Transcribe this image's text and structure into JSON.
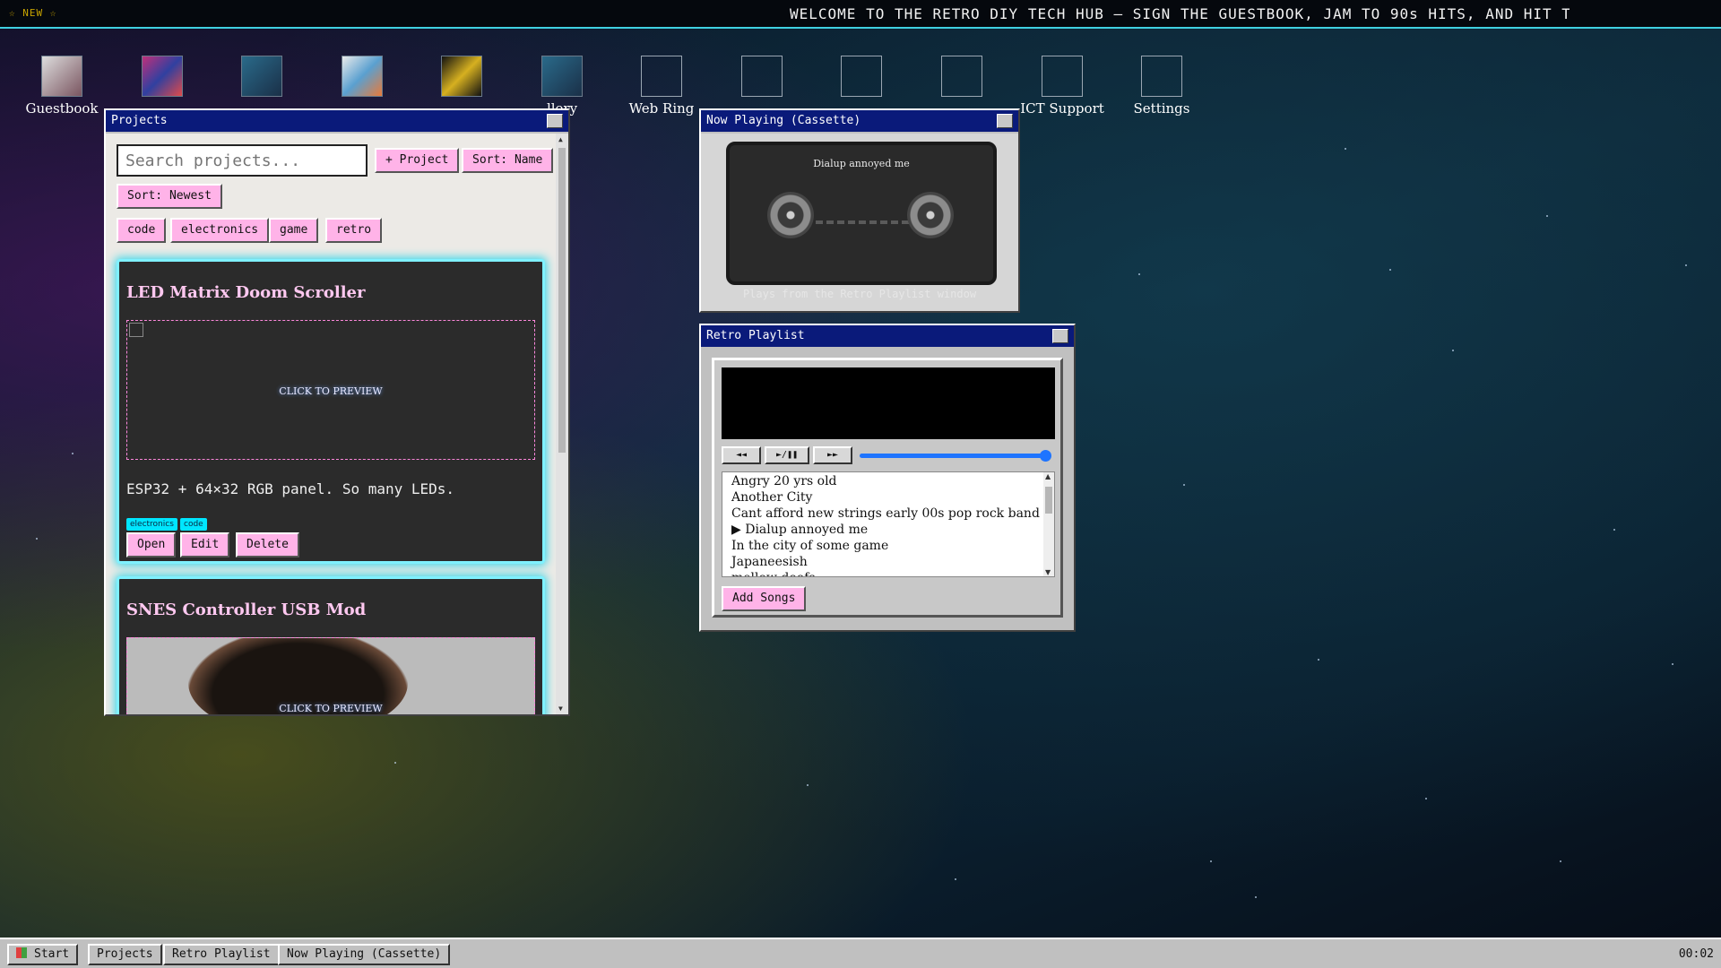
{
  "marquee": {
    "badge": "☆ NEW ☆",
    "text": "WELCOME TO THE RETRO DIY TECH HUB — SIGN THE GUESTBOOK, JAM TO 90s HITS, AND HIT THE ARCADE"
  },
  "desktop_icons": [
    {
      "label": "Guestbook",
      "icon": "guestbook-thumbnail"
    },
    {
      "label": "",
      "icon": "arcade-thumbnail"
    },
    {
      "label": "",
      "icon": "bomb-game-thumbnail"
    },
    {
      "label": "",
      "icon": "pixel-art-thumbnail"
    },
    {
      "label": "",
      "icon": "sandbox-thumbnail"
    },
    {
      "label": "llery",
      "icon": "gallery-thumbnail"
    },
    {
      "label": "Web Ring",
      "icon": "broken-image-icon"
    },
    {
      "label": "",
      "icon": "broken-image-icon"
    },
    {
      "label": "",
      "icon": "broken-image-icon"
    },
    {
      "label": "",
      "icon": "broken-image-icon"
    },
    {
      "label": "ICT Support",
      "icon": "broken-image-icon"
    },
    {
      "label": "Settings",
      "icon": "broken-image-icon"
    }
  ],
  "projects": {
    "title": "Projects",
    "search_placeholder": "Search projects...",
    "add_label": "+ Project",
    "sort_name_label": "Sort: Name",
    "sort_newest_label": "Sort: Newest",
    "filters": [
      "code",
      "electronics",
      "game",
      "retro"
    ],
    "cards": [
      {
        "title": "LED Matrix Doom Scroller",
        "preview_cta": "CLICK TO PREVIEW",
        "description": "ESP32 + 64×32 RGB panel. So many LEDs.",
        "tags": [
          "electronics",
          "code"
        ],
        "actions": [
          "Open",
          "Edit",
          "Delete"
        ]
      },
      {
        "title": "SNES Controller USB Mod",
        "preview_cta": "CLICK TO PREVIEW"
      }
    ]
  },
  "cassette": {
    "title": "Now Playing (Cassette)",
    "song": "Dialup annoyed me",
    "caption": "Plays from the Retro Playlist window"
  },
  "playlist": {
    "title": "Retro Playlist",
    "controls": {
      "rewind": "◄◄",
      "play_pause": "►/❚❚",
      "forward": "►►"
    },
    "progress": 1.0,
    "songs": [
      "Angry 20 yrs old",
      "Another City",
      "Cant afford new strings early 00s pop rock band",
      "▶ Dialup annoyed me",
      "In the city of some game",
      "Japaneesish",
      "mellow doofs"
    ],
    "add_label": "Add Songs"
  },
  "taskbar": {
    "start_label": "Start",
    "windows": [
      "Projects",
      "Retro Playlist",
      "Now Playing (Cassette)"
    ],
    "clock": "00:02"
  },
  "colors": {
    "accent_pink": "#ffb3e8",
    "neon_cyan": "#7ff1ff",
    "title_bar": "#0a1a7a"
  }
}
